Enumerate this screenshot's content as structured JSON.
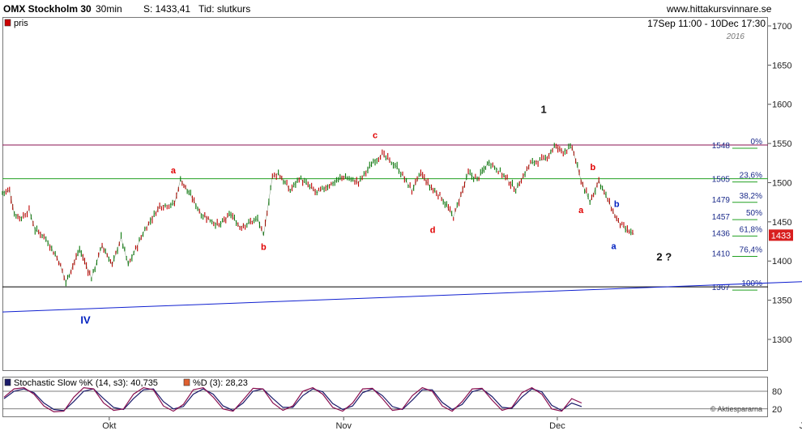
{
  "header": {
    "instrument": "OMX Stockholm 30",
    "interval": "30min",
    "last_label": "S: 1433,41",
    "time_label": "Tid: slutkurs",
    "site": "www.hittakursvinnare.se"
  },
  "main_panel": {
    "legend_label": "pris",
    "range_label": "17Sep 11:00 - 10Dec 17:30",
    "year_label": "2016",
    "last_price_tag": "1433",
    "colors": {
      "up": "#0a7a0a",
      "down": "#c00000",
      "fib_line": "#22a022",
      "resistance": "#8a1050",
      "trend": "#1020d0",
      "wave_red": "#e00000",
      "wave_blue": "#0020c0"
    }
  },
  "sub_panel": {
    "k_label": "Stochastic Slow %K (14, s3): 40,735",
    "d_label": "%D (3): 28,23",
    "watermark": "© Aktiespararna",
    "k_color": "#8a1050",
    "d_color": "#1a1a6a"
  },
  "chart_data": [
    {
      "type": "line",
      "title": "OMX Stockholm 30",
      "yaxis": {
        "ticks": [
          1300,
          1350,
          1400,
          1450,
          1500,
          1550,
          1600,
          1650,
          1700
        ],
        "ylim": [
          1250,
          1705
        ]
      },
      "xaxis": {
        "ticks": [
          "Okt",
          "Nov",
          "Dec",
          "Jan"
        ],
        "x_index_range": [
          0,
          1290
        ],
        "tick_index": [
          180,
          575,
          935,
          1355
        ]
      },
      "series": [
        {
          "x": [
            0,
            12,
            20,
            32,
            45,
            55,
            70,
            80,
            95,
            107,
            130,
            150,
            168,
            185,
            200,
            212,
            240,
            265,
            290,
            300,
            320,
            335,
            365,
            385,
            400,
            430,
            440,
            455,
            465,
            485,
            500,
            530,
            575,
            600,
            625,
            640,
            665,
            690,
            705,
            720,
            740,
            760,
            785,
            800,
            820,
            845,
            865,
            890,
            915,
            930,
            945,
            960,
            975,
            990,
            1005,
            1020,
            1035,
            1050,
            1065
          ],
          "values": [
            1487,
            1490,
            1460,
            1455,
            1465,
            1440,
            1432,
            1420,
            1400,
            1373,
            1415,
            1378,
            1420,
            1395,
            1430,
            1395,
            1440,
            1470,
            1473,
            1504,
            1480,
            1460,
            1445,
            1460,
            1443,
            1454,
            1432,
            1508,
            1512,
            1490,
            1506,
            1487,
            1508,
            1500,
            1527,
            1536,
            1520,
            1490,
            1512,
            1495,
            1481,
            1456,
            1512,
            1504,
            1527,
            1509,
            1491,
            1525,
            1530,
            1546,
            1540,
            1545,
            1503,
            1475,
            1503,
            1478,
            1453,
            1440,
            1434
          ]
        }
      ],
      "horizontal_lines": [
        {
          "label": "0%",
          "value": 1548
        },
        {
          "label": "23,6%",
          "value": 1505
        },
        {
          "label": "38,2%",
          "value": 1479
        },
        {
          "label": "50%",
          "value": 1457
        },
        {
          "label": "61,8%",
          "value": 1436
        },
        {
          "label": "76,4%",
          "value": 1410
        },
        {
          "label": "100%",
          "value": 1367
        }
      ],
      "trendline": {
        "from": [
          0,
          1335
        ],
        "to": [
          1360,
          1374
        ]
      },
      "wave_labels": [
        {
          "text": "IV",
          "x": 140,
          "y": 1320,
          "color": "blue"
        },
        {
          "text": "a",
          "x": 288,
          "y": 1512,
          "color": "red"
        },
        {
          "text": "b",
          "x": 440,
          "y": 1414,
          "color": "red"
        },
        {
          "text": "c",
          "x": 628,
          "y": 1557,
          "color": "red"
        },
        {
          "text": "d",
          "x": 725,
          "y": 1436,
          "color": "red"
        },
        {
          "text": "1",
          "x": 912,
          "y": 1589,
          "color": "black"
        },
        {
          "text": "b",
          "x": 995,
          "y": 1516,
          "color": "red"
        },
        {
          "text": "a",
          "x": 975,
          "y": 1461,
          "color": "red"
        },
        {
          "text": "b",
          "x": 1035,
          "y": 1469,
          "color": "blue"
        },
        {
          "text": "a",
          "x": 1030,
          "y": 1415,
          "color": "blue"
        },
        {
          "text": "2 ?",
          "x": 1115,
          "y": 1401,
          "color": "black"
        }
      ]
    },
    {
      "type": "line",
      "title": "Stochastic Slow",
      "yaxis": {
        "ticks": [
          20,
          80
        ],
        "ylim": [
          0,
          100
        ]
      },
      "series": [
        {
          "name": "Stochastic Slow %K (14, s3)",
          "values": [
            60,
            88,
            92,
            70,
            30,
            10,
            12,
            60,
            92,
            88,
            40,
            15,
            20,
            70,
            92,
            85,
            30,
            12,
            35,
            85,
            92,
            60,
            20,
            12,
            50,
            90,
            88,
            40,
            15,
            30,
            80,
            92,
            70,
            25,
            12,
            40,
            88,
            90,
            55,
            15,
            20,
            65,
            92,
            80,
            30,
            12,
            45,
            88,
            90,
            50,
            15,
            25,
            75,
            92,
            70,
            20,
            12,
            55,
            40
          ]
        },
        {
          "name": "%D (3)",
          "values": [
            55,
            80,
            88,
            75,
            40,
            18,
            14,
            45,
            80,
            88,
            55,
            25,
            18,
            55,
            85,
            88,
            45,
            20,
            28,
            70,
            88,
            70,
            30,
            15,
            40,
            80,
            88,
            55,
            25,
            25,
            65,
            88,
            78,
            38,
            18,
            30,
            75,
            88,
            65,
            28,
            18,
            50,
            85,
            85,
            42,
            18,
            35,
            78,
            88,
            62,
            25,
            22,
            60,
            88,
            78,
            32,
            15,
            40,
            28
          ]
        }
      ]
    }
  ]
}
